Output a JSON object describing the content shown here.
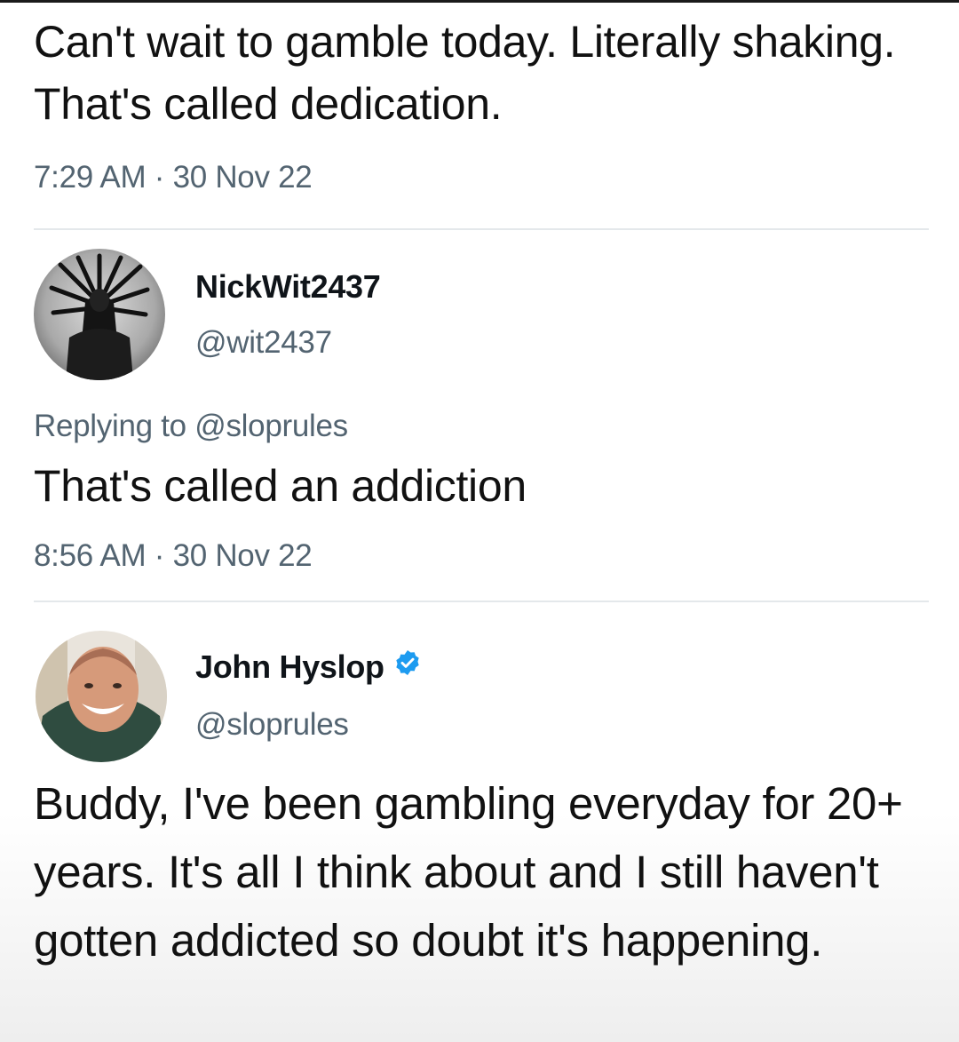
{
  "original_tweet": {
    "text": "Can't wait to gamble today. Literally shaking. That's called dedication.",
    "time": "7:29 AM",
    "date": "30 Nov 22"
  },
  "reply_1": {
    "display_name": "NickWit2437",
    "handle": "@wit2437",
    "replying_label": "Replying to",
    "replying_to": "@sloprules",
    "text": "That's called an addiction",
    "time": "8:56 AM",
    "date": "30 Nov 22",
    "avatar_icon": "dark-figure-avatar-icon"
  },
  "reply_2": {
    "display_name": "John Hyslop",
    "handle": "@sloprules",
    "verified_icon": "verified-badge-icon",
    "text": "Buddy, I've been gambling everyday for 20+ years. It's all I think about and I still haven't gotten addicted so doubt it's happening.",
    "avatar_icon": "smiling-man-avatar-icon"
  },
  "meta_separator": "·",
  "colors": {
    "text": "#0f1419",
    "secondary": "#536471",
    "verified": "#1d9bf0",
    "divider": "#e4e8eb"
  }
}
